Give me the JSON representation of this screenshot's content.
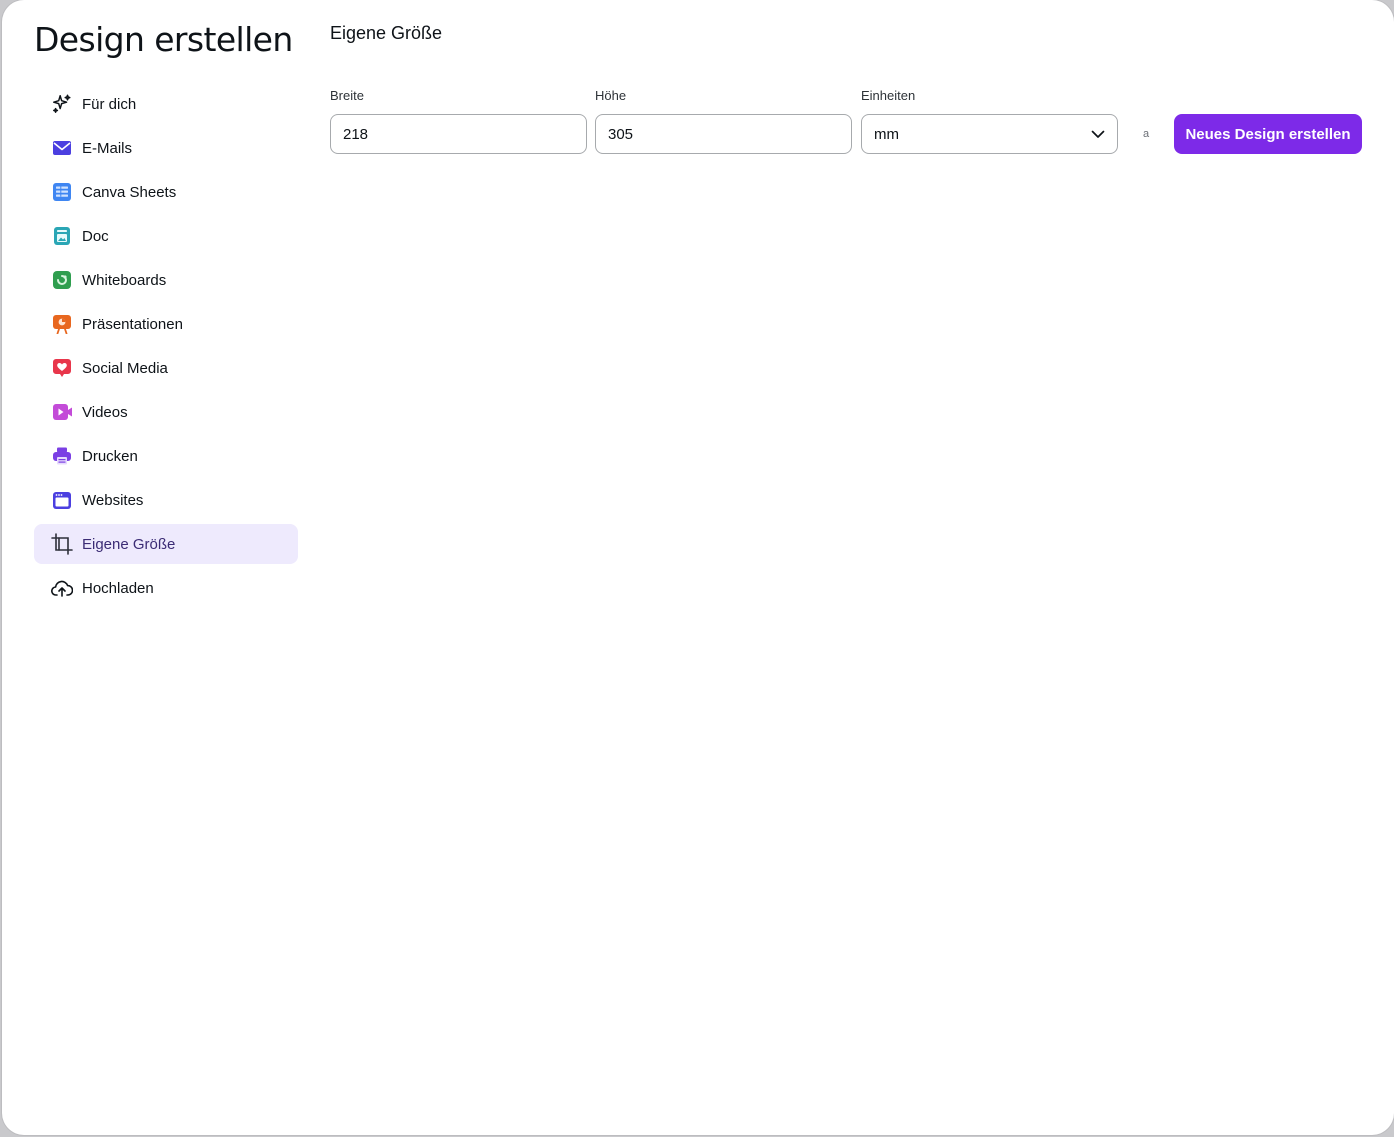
{
  "dialog": {
    "title": "Design erstellen"
  },
  "sidebar": {
    "items": [
      {
        "label": "Für dich",
        "icon": "sparkle-icon"
      },
      {
        "label": "E-Mails",
        "icon": "envelope-icon"
      },
      {
        "label": "Canva Sheets",
        "icon": "sheet-icon"
      },
      {
        "label": "Doc",
        "icon": "doc-icon"
      },
      {
        "label": "Whiteboards",
        "icon": "whiteboard-icon"
      },
      {
        "label": "Präsentationen",
        "icon": "presentation-icon"
      },
      {
        "label": "Social Media",
        "icon": "heart-icon"
      },
      {
        "label": "Videos",
        "icon": "video-icon"
      },
      {
        "label": "Drucken",
        "icon": "printer-icon"
      },
      {
        "label": "Websites",
        "icon": "website-icon"
      },
      {
        "label": "Eigene Größe",
        "icon": "custom-size-icon",
        "active": true
      },
      {
        "label": "Hochladen",
        "icon": "upload-cloud-icon"
      }
    ]
  },
  "main": {
    "title": "Eigene Größe",
    "width_label": "Breite",
    "width_value": "218",
    "height_label": "Höhe",
    "height_value": "305",
    "units_label": "Einheiten",
    "units_value": "mm",
    "lock_glyph": "a",
    "create_button": "Neues Design erstellen"
  },
  "colors": {
    "accent": "#7d2ae8",
    "active_bg": "#eeeafd"
  }
}
